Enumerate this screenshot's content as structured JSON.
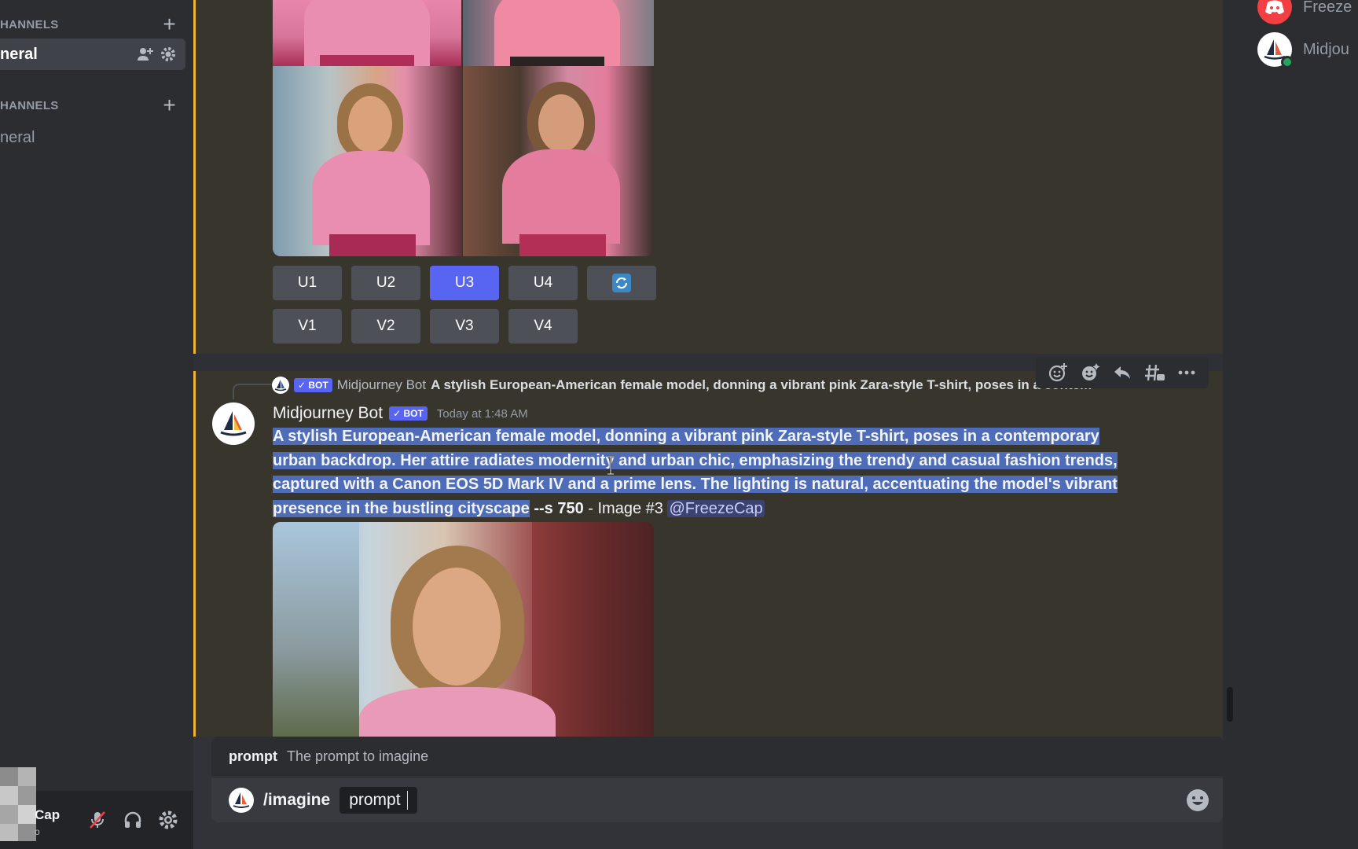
{
  "sidebar": {
    "category_text": "HANNELS",
    "category_voice": "HANNELS",
    "active_channel": "neral",
    "voice_channel": "neral"
  },
  "user_panel": {
    "name": "Cap",
    "status": "o"
  },
  "grid_message": {
    "upscale_buttons": [
      "U1",
      "U2",
      "U3",
      "U4"
    ],
    "variation_buttons": [
      "V1",
      "V2",
      "V3",
      "V4"
    ],
    "selected_button": "U3",
    "reroll_icon": "refresh-icon"
  },
  "message": {
    "reply_badge": "✓ BOT",
    "reply_author": "Midjourney Bot",
    "reply_text": "A stylish European-American female model, donning a vibrant pink Zara-style T-shirt, poses in a contem",
    "author": "Midjourney Bot",
    "badge": "✓ BOT",
    "timestamp": "Today at 1:48 AM",
    "line1": "A stylish European-American female model, donning a vibrant pink Zara-style T-shirt, poses in a contemporary",
    "line2": "urban backdrop. Her attire radiates modernity and urban chic, emphasizing the trendy and casual fashion trends,",
    "line3": "captured with a Canon EOS 5D Mark IV and a prime lens. The lighting is natural, accentuating the model's vibrant",
    "line4": "presence in the bustling cityscape",
    "flags": "--s 750",
    "suffix": " - Image #3 ",
    "mention": "@FreezeCap"
  },
  "toolbar": {
    "icons": [
      "add-reaction-icon",
      "super-reaction-icon",
      "reply-icon",
      "create-thread-icon",
      "more-icon"
    ]
  },
  "command": {
    "hint_key": "prompt",
    "hint_desc": "The prompt to imagine",
    "name": "/imagine",
    "option": "prompt"
  },
  "members": [
    {
      "name": "Freeze",
      "color": "#f23f43"
    },
    {
      "name": "Midjou",
      "color": "#ffffff"
    }
  ]
}
